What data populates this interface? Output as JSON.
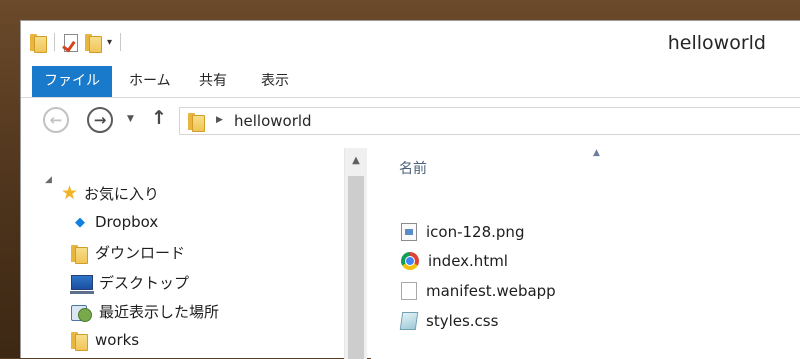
{
  "window": {
    "title": "helloworld"
  },
  "ribbon": {
    "tabs": [
      {
        "label": "ファイル",
        "active": true
      },
      {
        "label": "ホーム"
      },
      {
        "label": "共有"
      },
      {
        "label": "表示"
      }
    ],
    "accent_color": "#1979ca"
  },
  "address": {
    "path": "helloworld"
  },
  "nav_pane": {
    "items": [
      {
        "label": "お気に入り",
        "icon": "star-icon"
      },
      {
        "label": "Dropbox",
        "icon": "dropbox-icon"
      },
      {
        "label": "ダウンロード",
        "icon": "download-folder-icon"
      },
      {
        "label": "デスクトップ",
        "icon": "desktop-icon"
      },
      {
        "label": "最近表示した場所",
        "icon": "recent-places-icon"
      },
      {
        "label": "works",
        "icon": "folder-icon"
      }
    ]
  },
  "content": {
    "column_header": "名前",
    "files": [
      {
        "name": "icon-128.png",
        "icon": "image-file-icon"
      },
      {
        "name": "index.html",
        "icon": "chrome-icon"
      },
      {
        "name": "manifest.webapp",
        "icon": "document-icon"
      },
      {
        "name": "styles.css",
        "icon": "css-file-icon"
      }
    ]
  }
}
